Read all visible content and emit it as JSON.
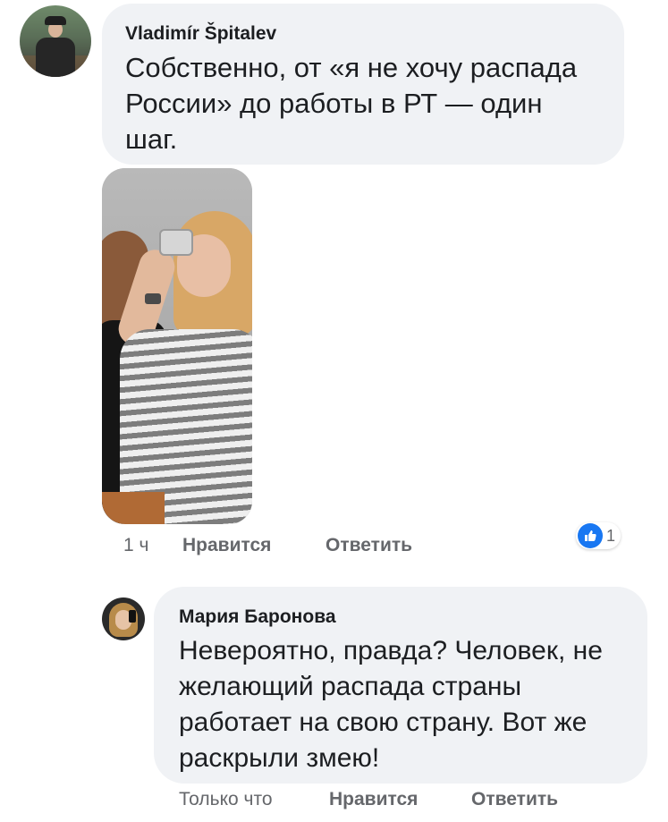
{
  "comments": [
    {
      "author": "Vladimír Špitalev",
      "text": "Собственно, от «я не хочу распада России» до работы в РТ — один шаг.",
      "time": "1 ч",
      "like_label": "Нравится",
      "reply_label": "Ответить",
      "reactions": {
        "icon": "thumbs-up-icon",
        "count": "1",
        "color": "#1877f2"
      }
    },
    {
      "author": "Мария Баронова",
      "text": "Невероятно, правда? Человек, не желающий распада страны работает на свою страну. Вот же раскрыли змею!",
      "time": "Только что",
      "like_label": "Нравится",
      "reply_label": "Ответить"
    }
  ],
  "colors": {
    "bubble": "#f0f2f5",
    "meta_text": "#65676b",
    "primary_text": "#1c1e21",
    "accent": "#1877f2"
  }
}
